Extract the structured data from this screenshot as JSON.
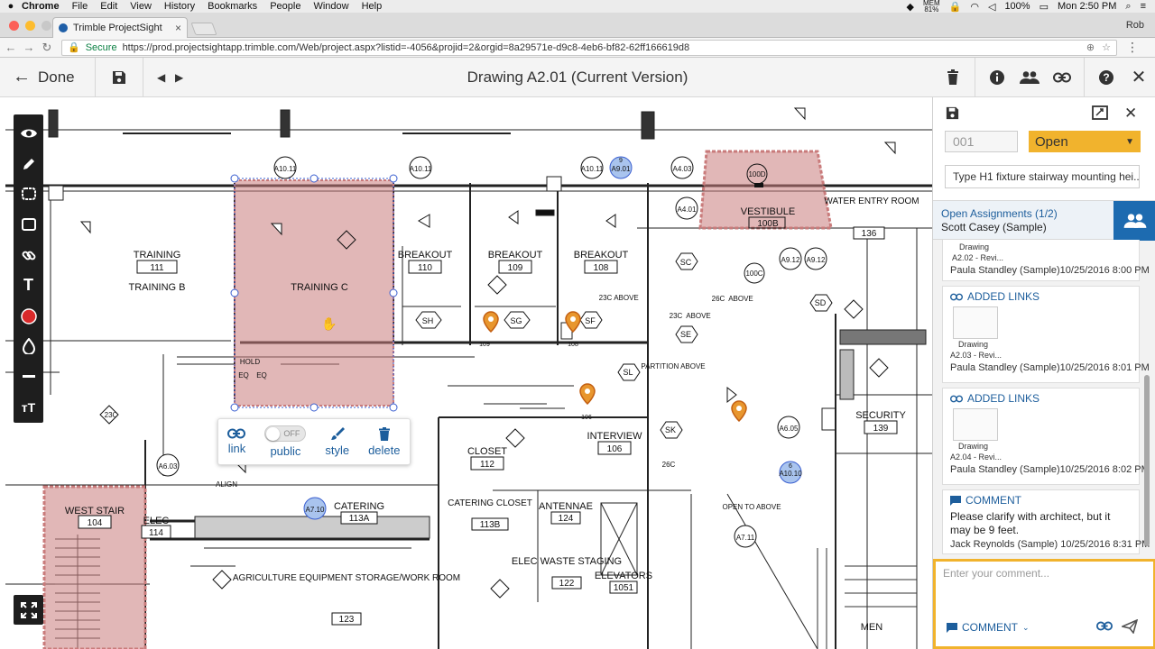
{
  "mac_menu": {
    "app_name": "Chrome",
    "menus": [
      "File",
      "Edit",
      "View",
      "History",
      "Bookmarks",
      "People",
      "Window",
      "Help"
    ],
    "battery_top": "MEM",
    "battery_bottom": "81%",
    "battery_pct": "100%",
    "clock": "Mon 2:50 PM"
  },
  "browser": {
    "tab_title": "Trimble ProjectSight",
    "profile": "Rob",
    "secure_label": "Secure",
    "url": "https://prod.projectsightapp.trimble.com/Web/project.aspx?listid=-4056&projid=2&orgid=8a29571e-d9c8-4eb6-bf82-62ff166619d8"
  },
  "header": {
    "done_label": "Done",
    "title": "Drawing A2.01 (Current Version)"
  },
  "popup": {
    "link_label": "link",
    "toggle_state": "OFF",
    "public_label": "public",
    "style_label": "style",
    "delete_label": "delete"
  },
  "panel": {
    "number_placeholder": "001",
    "status": "Open",
    "description": "Type H1 fixture stairway mounting hei...",
    "assignments_title": "Open Assignments (1/2)",
    "assignee": "Scott Casey (Sample)",
    "activity": [
      {
        "head": "",
        "caption1": "Drawing",
        "caption2": "A2.02 - Revi...",
        "meta": "Paula Standley (Sample)10/25/2016 8:00 PM"
      },
      {
        "head": "ADDED LINKS",
        "caption1": "Drawing",
        "caption2": "A2.03 - Revi...",
        "meta": "Paula Standley (Sample)10/25/2016 8:01 PM"
      },
      {
        "head": "ADDED LINKS",
        "caption1": "Drawing",
        "caption2": "A2.04 - Revi...",
        "meta": "Paula Standley (Sample)10/25/2016 8:02 PM"
      },
      {
        "head": "COMMENT",
        "text": "Please clarify with architect, but it may be 9 feet.",
        "meta": "Jack Reynolds (Sample) 10/25/2016 8:31 PM"
      }
    ],
    "comment_placeholder": "Enter your comment...",
    "comment_type": "COMMENT"
  },
  "drawing": {
    "rooms": [
      {
        "name": "TRAINING",
        "num": "111"
      },
      {
        "name": "TRAINING B",
        "num": ""
      },
      {
        "name": "TRAINING C",
        "num": ""
      },
      {
        "name": "BREAKOUT",
        "num": "110"
      },
      {
        "name": "BREAKOUT",
        "num": "109"
      },
      {
        "name": "BREAKOUT",
        "num": "108"
      },
      {
        "name": "VESTIBULE",
        "num": "100B"
      },
      {
        "name": "WATER ENTRY ROOM",
        "num": "136"
      },
      {
        "name": "CLOSET",
        "num": "112"
      },
      {
        "name": "INTERVIEW",
        "num": "106"
      },
      {
        "name": "SECURITY",
        "num": "139"
      },
      {
        "name": "WEST STAIR",
        "num": "104"
      },
      {
        "name": "ELEC",
        "num": "114"
      },
      {
        "name": "CATERING",
        "num": "113A"
      },
      {
        "name": "CATERING CLOSET",
        "num": "113B"
      },
      {
        "name": "ANTENNAE",
        "num": "124"
      },
      {
        "name": "ELEC WASTE STAGING",
        "num": "122"
      },
      {
        "name": "ELEVATORS",
        "num": "1051"
      },
      {
        "name": "AGRICULTURE EQUIPMENT STORAGE/WORK ROOM",
        "num": "123"
      },
      {
        "name": "MEN",
        "num": ""
      }
    ],
    "labels": [
      "A10.11",
      "A10.11",
      "A9.01",
      "A7.14",
      "A7.14",
      "A7.14",
      "A9.12",
      "A9.12",
      "A7.14",
      "A7.10",
      "A10.10",
      "A6.05",
      "A6.03",
      "A7.11",
      "A7.11",
      "A7.11",
      "A4.01",
      "A4.03",
      "100D",
      "100C",
      "23C",
      "23C",
      "23C",
      "26C",
      "26C",
      "SH",
      "SG",
      "SF",
      "SC",
      "SD",
      "SE",
      "SL",
      "SK",
      "ABOVE",
      "ABOVE",
      "ABOVE",
      "PARTITION ABOVE",
      "OPEN TO ABOVE",
      "ALIGN",
      "HOLD",
      "EQ",
      "EQ"
    ],
    "pins": [
      "109",
      "108",
      "106",
      "",
      ""
    ],
    "callouts": [
      "9",
      "6",
      ""
    ]
  }
}
